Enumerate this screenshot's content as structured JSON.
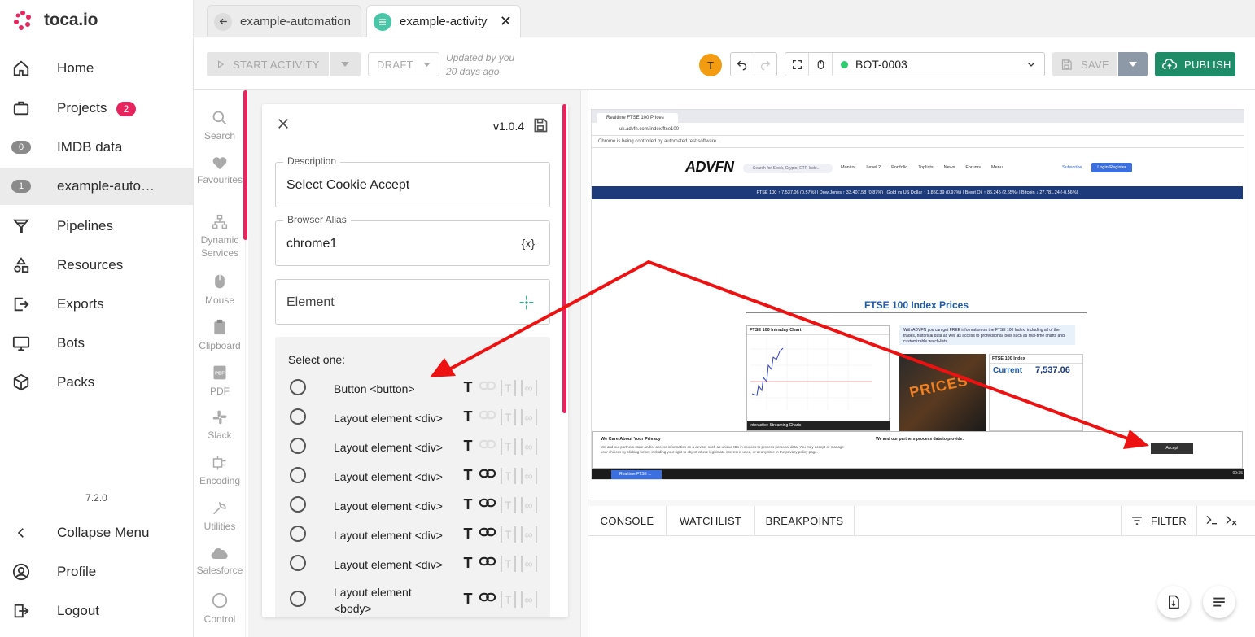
{
  "brand": {
    "name": "toca.io",
    "accent": "#e8245e"
  },
  "nav": {
    "items": [
      {
        "label": "Home",
        "icon": "home-icon"
      },
      {
        "label": "Projects",
        "icon": "briefcase-icon",
        "badge": "2"
      },
      {
        "label": "IMDB data",
        "icon": "count-badge",
        "count": "0"
      },
      {
        "label": "example-auto…",
        "icon": "count-badge",
        "count": "1"
      },
      {
        "label": "Pipelines",
        "icon": "funnel-icon"
      },
      {
        "label": "Resources",
        "icon": "shapes-icon"
      },
      {
        "label": "Exports",
        "icon": "export-icon"
      },
      {
        "label": "Bots",
        "icon": "monitor-icon"
      },
      {
        "label": "Packs",
        "icon": "box-icon"
      }
    ],
    "version": "7.2.0",
    "collapse": "Collapse Menu",
    "profile": "Profile",
    "logout": "Logout"
  },
  "tabs": [
    {
      "label": "example-automation"
    },
    {
      "label": "example-activity"
    }
  ],
  "toolbar": {
    "start": "START ACTIVITY",
    "draft": "DRAFT",
    "updated_line1": "Updated by you",
    "updated_line2": "20 days ago",
    "avatar": "T",
    "bot": "BOT-0003",
    "save": "SAVE",
    "publish": "PUBLISH"
  },
  "activities": [
    {
      "label": "Search",
      "icon": "search-icon"
    },
    {
      "label": "Favourites",
      "icon": "heart-icon"
    },
    {
      "label": "Dynamic Services",
      "icon": "dynamic-services-icon"
    },
    {
      "label": "Mouse",
      "icon": "mouse-icon"
    },
    {
      "label": "Clipboard",
      "icon": "clipboard-icon"
    },
    {
      "label": "PDF",
      "icon": "pdf-icon"
    },
    {
      "label": "Slack",
      "icon": "slack-icon"
    },
    {
      "label": "Encoding",
      "icon": "encoding-icon"
    },
    {
      "label": "Utilities",
      "icon": "wrench-icon"
    },
    {
      "label": "Salesforce",
      "icon": "cloud-icon"
    },
    {
      "label": "Control",
      "icon": "control-icon"
    }
  ],
  "panel": {
    "version": "v1.0.4",
    "description_label": "Description",
    "description_value": "Select Cookie Accept",
    "alias_label": "Browser Alias",
    "alias_value": "chrome1",
    "alias_var": "{x}",
    "element_label": "Element",
    "select_title": "Select one:",
    "options": [
      "Button <button>",
      "Layout element <div>",
      "Layout element <div>",
      "Layout element <div>",
      "Layout element <div>",
      "Layout element <div>",
      "Layout element <div>",
      "Layout element <body>"
    ]
  },
  "browser": {
    "tab_title": "Realtime FTSE 100 Prices",
    "url": "uk.advfn.com/index/ftse100",
    "info_bar": "Chrome is being controlled by automated test software.",
    "site": {
      "logo": "ADVFN",
      "search_placeholder": "Search for Stock, Crypto, ETF, Inde...",
      "nav": [
        "Monitor",
        "Level 2",
        "Portfolio",
        "Toplists",
        "News",
        "Forums",
        "Menu"
      ],
      "subscribe": "Subscribe",
      "login": "Login/Register",
      "ticker": "FTSE 100 ↑ 7,537.06 (0.57%) | Dow Jones ↑ 33,407.58 (0.87%) | Gold vs US Dollar ↑ 1,850.39 (0.97%) | Brent Oil ↑ 86.245 (2.65%) | Bitcoin ↓ 27,781.24 (-0.56%)",
      "page_title": "FTSE 100 Index Prices",
      "chart_title": "FTSE 100 Intraday Chart",
      "chart_footer": "Interactive Streaming Charts",
      "info_text": "With ADVFN you can get FREE information on the FTSE 100 Index, including all of the trades, historical data as well as access to professional tools such as real-time charts and customizable watch-lists.",
      "photo_text": "PRICES",
      "quote_title": "FTSE 100 Index",
      "quote_label": "Current",
      "quote_value": "7,537.06",
      "cookie_title": "We Care About Your Privacy",
      "cookie_text": "We and our partners store and/or access information on a device, such as unique IDs in cookies to process personal data. You may accept or manage your choices by clicking below, including your right to object where legitimate interest is used, or at any time in the privacy policy page.",
      "cookie_title2": "We and our partners process data to provide:",
      "accept": "Accept"
    },
    "taskbar_app": "Realtime FTSE ...",
    "taskbar_time": "09:35"
  },
  "console": {
    "tabs": [
      "CONSOLE",
      "WATCHLIST",
      "BREAKPOINTS"
    ],
    "filter": "FILTER"
  }
}
